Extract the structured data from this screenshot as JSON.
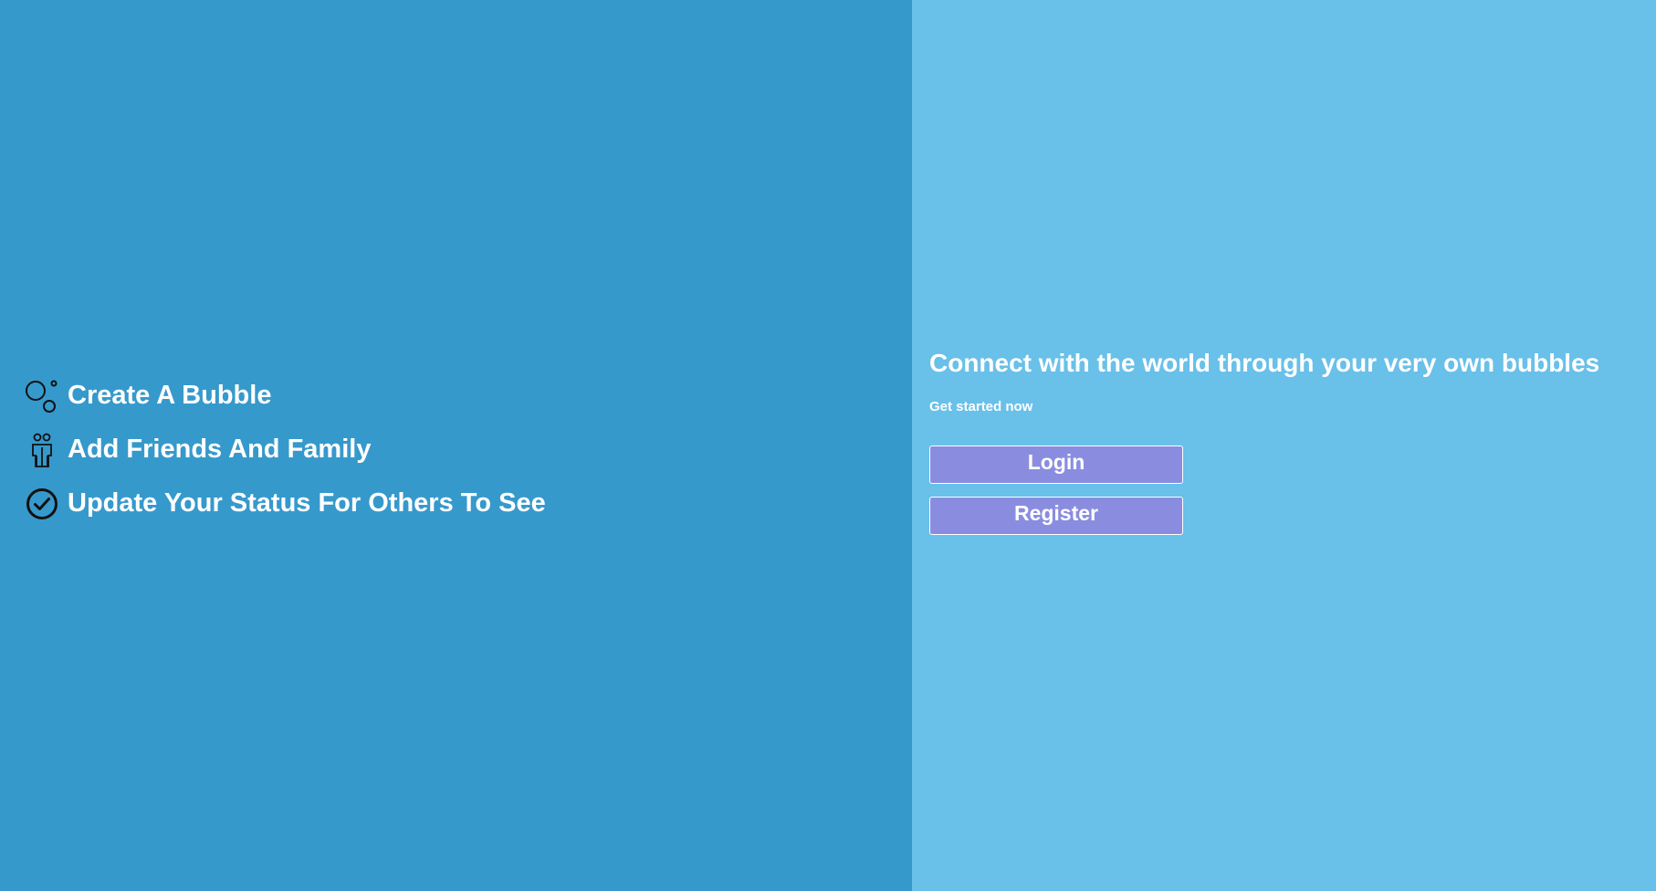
{
  "features": [
    {
      "label": "Create A Bubble",
      "icon": "bubbles-icon"
    },
    {
      "label": "Add Friends And Family",
      "icon": "people-icon"
    },
    {
      "label": "Update Your Status For Others To See",
      "icon": "check-circle-icon"
    }
  ],
  "hero": {
    "headline": "Connect with the world through your very own bubbles",
    "subline": "Get started now"
  },
  "actions": {
    "login_label": "Login",
    "register_label": "Register"
  },
  "colors": {
    "left_panel": "#3699cc",
    "right_panel": "#69c0e9",
    "button": "#8a8ddf",
    "text": "#ffffff"
  }
}
